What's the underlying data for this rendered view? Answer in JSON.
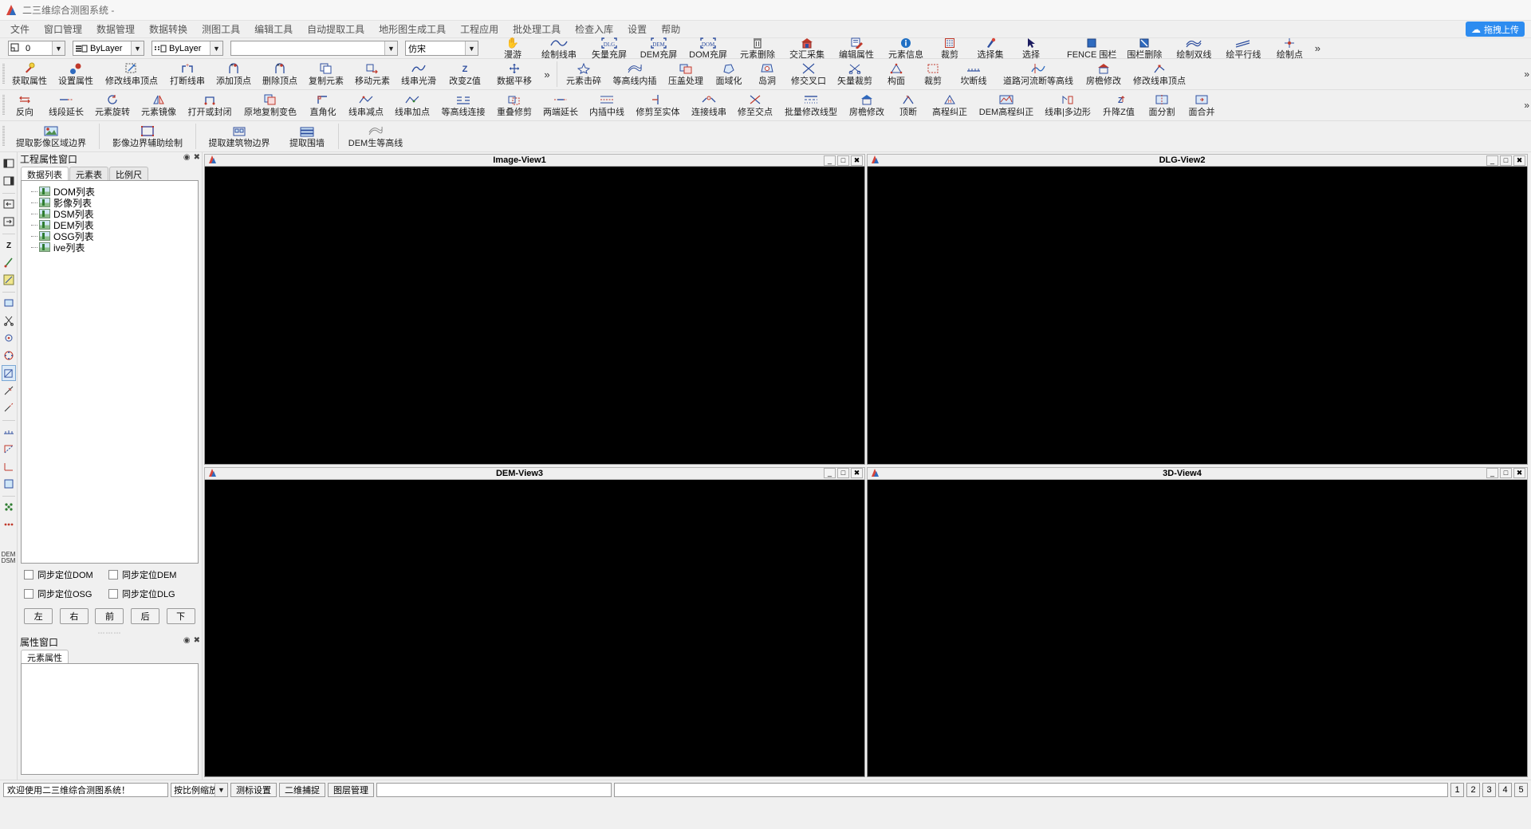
{
  "window": {
    "title": "二三维综合测图系统 -",
    "app_icon": "app-logo-icon"
  },
  "menubar": {
    "items": [
      "文件",
      "窗口管理",
      "数据管理",
      "数据转换",
      "测图工具",
      "编辑工具",
      "自动提取工具",
      "地形图生成工具",
      "工程应用",
      "批处理工具",
      "检查入库",
      "设置",
      "帮助"
    ],
    "upload_button": "拖拽上传"
  },
  "toolbar_row1": {
    "layer_combo": {
      "value": "0",
      "icon": "layer-icon"
    },
    "color_combo": {
      "value": "ByLayer",
      "icon": "color-lines-icon"
    },
    "linetype_combo": {
      "value": "ByLayer",
      "icon": "linetype-icon"
    },
    "lineweight_combo": {
      "value": ""
    },
    "font_combo": {
      "value": "仿宋"
    },
    "buttons": [
      {
        "label": "漫游",
        "icon": "hand-pan-icon"
      },
      {
        "label": "绘制线串",
        "icon": "polyline-draw-icon"
      },
      {
        "label": "矢量充屏",
        "icon": "dlg-fit-icon"
      },
      {
        "label": "DEM充屏",
        "icon": "dem-fit-icon"
      },
      {
        "label": "DOM充屏",
        "icon": "dom-fit-icon"
      },
      {
        "label": "元素删除",
        "icon": "trash-icon"
      },
      {
        "label": "交汇采集",
        "icon": "house-collect-icon"
      },
      {
        "label": "编辑属性",
        "icon": "edit-attr-icon"
      },
      {
        "label": "元素信息",
        "icon": "info-icon"
      },
      {
        "label": "裁剪",
        "icon": "crop-icon"
      },
      {
        "label": "选择集",
        "icon": "select-set-icon"
      },
      {
        "label": "选择",
        "icon": "arrow-select-icon"
      },
      {
        "label": "FENCE 围栏",
        "icon": "fence-icon"
      },
      {
        "label": "围栏删除",
        "icon": "fence-delete-icon"
      },
      {
        "label": "绘制双线",
        "icon": "double-line-icon"
      },
      {
        "label": "绘平行线",
        "icon": "parallel-line-icon"
      },
      {
        "label": "绘制点",
        "icon": "draw-point-icon"
      }
    ]
  },
  "toolbar_row2": {
    "buttons": [
      {
        "label": "获取属性",
        "icon": "pick-attr-icon"
      },
      {
        "label": "设置属性",
        "icon": "set-attr-icon"
      },
      {
        "label": "修改线串顶点",
        "icon": "edit-vertex-icon"
      },
      {
        "label": "打断线串",
        "icon": "break-line-icon"
      },
      {
        "label": "添加顶点",
        "icon": "add-vertex-icon"
      },
      {
        "label": "删除顶点",
        "icon": "del-vertex-icon"
      },
      {
        "label": "复制元素",
        "icon": "copy-elem-icon"
      },
      {
        "label": "移动元素",
        "icon": "move-elem-icon"
      },
      {
        "label": "线串光滑",
        "icon": "smooth-line-icon"
      },
      {
        "label": "改变Z值",
        "icon": "change-z-icon"
      },
      {
        "label": "数据平移",
        "icon": "pan-data-icon"
      },
      {
        "label": "元素击碎",
        "icon": "explode-icon"
      },
      {
        "label": "等高线内插",
        "icon": "contour-interp-icon"
      },
      {
        "label": "压盖处理",
        "icon": "overlap-process-icon"
      },
      {
        "label": "面域化",
        "icon": "region-icon"
      },
      {
        "label": "岛洞",
        "icon": "island-hole-icon"
      },
      {
        "label": "修交叉口",
        "icon": "fix-cross-icon"
      },
      {
        "label": "矢量裁剪",
        "icon": "vector-clip-icon"
      },
      {
        "label": "构面",
        "icon": "build-face-icon"
      },
      {
        "label": "裁剪",
        "icon": "clip-icon"
      },
      {
        "label": "坎断线",
        "icon": "ridge-break-icon"
      },
      {
        "label": "道路河流断等高线",
        "icon": "road-river-contour-icon"
      },
      {
        "label": "房檐修改",
        "icon": "eave-edit-icon"
      },
      {
        "label": "修改线串顶点",
        "icon": "edit-vertex2-icon"
      }
    ]
  },
  "toolbar_row3": {
    "buttons": [
      {
        "label": "反向",
        "icon": "reverse-icon"
      },
      {
        "label": "线段延长",
        "icon": "extend-segment-icon"
      },
      {
        "label": "元素旋转",
        "icon": "rotate-elem-icon"
      },
      {
        "label": "元素镜像",
        "icon": "mirror-elem-icon"
      },
      {
        "label": "打开或封闭",
        "icon": "open-close-icon"
      },
      {
        "label": "原地复制变色",
        "icon": "copy-recolor-icon"
      },
      {
        "label": "直角化",
        "icon": "rectify-angle-icon"
      },
      {
        "label": "线串减点",
        "icon": "reduce-points-icon"
      },
      {
        "label": "线串加点",
        "icon": "add-points-icon"
      },
      {
        "label": "等高线连接",
        "icon": "contour-connect-icon"
      },
      {
        "label": "重叠修剪",
        "icon": "overlap-trim-icon"
      },
      {
        "label": "两端延长",
        "icon": "extend-both-icon"
      },
      {
        "label": "内插中线",
        "icon": "interp-center-icon"
      },
      {
        "label": "修剪至实体",
        "icon": "trim-to-entity-icon"
      },
      {
        "label": "连接线串",
        "icon": "join-line-icon"
      },
      {
        "label": "修至交点",
        "icon": "trim-to-intersection-icon"
      },
      {
        "label": "批量修改线型",
        "icon": "batch-linetype-icon"
      },
      {
        "label": "房檐修改",
        "icon": "eave-edit2-icon"
      },
      {
        "label": "顶断",
        "icon": "top-break-icon"
      },
      {
        "label": "高程纠正",
        "icon": "elev-correct-icon"
      },
      {
        "label": "DEM高程纠正",
        "icon": "dem-elev-correct-icon"
      },
      {
        "label": "线串|多边形",
        "icon": "line-polygon-icon"
      },
      {
        "label": "升降Z值",
        "icon": "raise-z-icon"
      },
      {
        "label": "面分割",
        "icon": "split-face-icon"
      },
      {
        "label": "面合并",
        "icon": "merge-face-icon"
      }
    ]
  },
  "toolbar_row4": {
    "buttons": [
      {
        "label": "提取影像区域边界",
        "icon": "extract-image-boundary-icon"
      },
      {
        "label": "影像边界辅助绘制",
        "icon": "image-boundary-assist-icon"
      },
      {
        "label": "提取建筑物边界",
        "icon": "extract-building-boundary-icon"
      },
      {
        "label": "提取围墙",
        "icon": "extract-wall-icon"
      },
      {
        "label": "DEM生等高线",
        "icon": "dem-contour-icon"
      }
    ]
  },
  "vertical_toolstrip": {
    "buttons": [
      "dock-left-icon",
      "dock-right-icon",
      "panel-left-icon",
      "panel-right-icon",
      "grid-icon",
      "zorder-icon",
      "scissors-icon",
      "marker-icon",
      "measure-icon",
      "snap-grid-icon",
      "polygon-snap-icon",
      "node-snap-icon",
      "midpoint-snap-icon",
      "perp-snap-icon",
      "extend-snap-icon",
      "tangent-snap-icon",
      "rect-snap-icon",
      "nearest-snap-icon",
      "none-snap-icon",
      "demdsm-icon"
    ],
    "selected_index": 11,
    "bottom_label": "DEM\nDSM"
  },
  "project_panel": {
    "title": "工程属性窗口",
    "tabs": [
      {
        "label": "数据列表",
        "active": true
      },
      {
        "label": "元素表",
        "active": false
      },
      {
        "label": "比例尺",
        "active": false
      }
    ],
    "tree_items": [
      "DOM列表",
      "影像列表",
      "DSM列表",
      "DEM列表",
      "OSG列表",
      "ive列表"
    ],
    "sync_checkboxes": [
      {
        "label": "同步定位DOM",
        "checked": false
      },
      {
        "label": "同步定位DEM",
        "checked": false
      },
      {
        "label": "同步定位OSG",
        "checked": false
      },
      {
        "label": "同步定位DLG",
        "checked": false
      }
    ],
    "nav_buttons": [
      "左",
      "右",
      "前",
      "后",
      "下"
    ]
  },
  "attribute_panel": {
    "title": "属性窗口",
    "tabs": [
      {
        "label": "元素属性",
        "active": true
      }
    ]
  },
  "viewports": [
    {
      "title": "Image-View1",
      "buttons": [
        "minimize",
        "maximize",
        "close"
      ]
    },
    {
      "title": "DLG-View2",
      "buttons": [
        "minimize",
        "maximize",
        "close"
      ]
    },
    {
      "title": "DEM-View3",
      "buttons": [
        "minimize",
        "maximize",
        "close"
      ]
    },
    {
      "title": "3D-View4",
      "buttons": [
        "minimize",
        "maximize",
        "close"
      ]
    }
  ],
  "statusbar": {
    "message": "欢迎使用二三维综合测图系统！",
    "scale_combo": "按比例缩放",
    "buttons": [
      "测标设置",
      "二维捕捉",
      "图层管理"
    ],
    "coord_field": "",
    "info_field": "",
    "page_numbers": [
      "1",
      "2",
      "3",
      "4",
      "5"
    ]
  },
  "colors": {
    "accent": "#2d8cf0",
    "canvas": "#000000",
    "chrome": "#f0f0f0",
    "icon_blue": "#2f4f9f",
    "icon_red": "#c0392b"
  }
}
